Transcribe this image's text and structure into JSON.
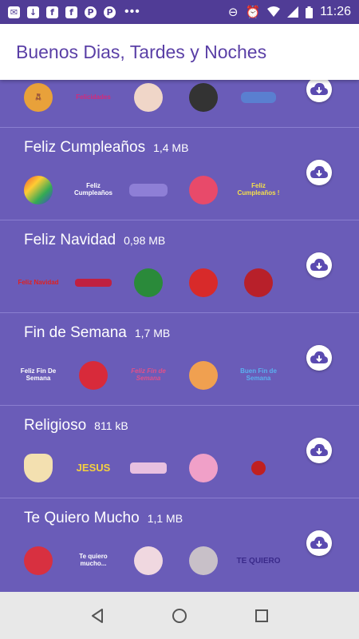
{
  "status_bar": {
    "left_icons": [
      "email-icon",
      "download-icon",
      "facebook-icon",
      "facebook-icon",
      "pinterest-icon",
      "pinterest-icon"
    ],
    "overflow": "•••",
    "right_icons": [
      "minus-circle-icon",
      "alarm-icon",
      "wifi-icon",
      "signal-icon",
      "battery-icon"
    ],
    "time": "11:26"
  },
  "app_bar": {
    "title": "Buenos Dias, Tardes y Noches"
  },
  "colors": {
    "background": "#6a5cb8",
    "status": "#503c96",
    "accent": "#5a3fa6"
  },
  "packs": [
    {
      "name": "",
      "size": "",
      "stickers": [
        "",
        "Felicidades",
        "",
        "",
        ""
      ]
    },
    {
      "name": "Feliz Cumpleaños",
      "size": "1,4 MB",
      "stickers": [
        "",
        "Feliz Cumpleaños",
        "",
        "",
        "Feliz Cumpleaños !"
      ]
    },
    {
      "name": "Feliz Navidad",
      "size": "0,98 MB",
      "stickers": [
        "Feliz Navidad",
        "",
        "",
        "",
        ""
      ]
    },
    {
      "name": "Fin de Semana",
      "size": "1,7 MB",
      "stickers": [
        "Feliz Fin De Semana",
        "",
        "Feliz Fin de Semana",
        "",
        "Buen Fin de Semana"
      ]
    },
    {
      "name": "Religioso",
      "size": "811 kB",
      "stickers": [
        "",
        "JESUS",
        "",
        "",
        ""
      ]
    },
    {
      "name": "Te Quiero Mucho",
      "size": "1,1 MB",
      "stickers": [
        "",
        "Te quiero mucho...",
        "",
        "",
        "TE QUIERO"
      ]
    }
  ],
  "nav": {
    "back": "back-icon",
    "home": "home-icon",
    "recents": "recents-icon"
  }
}
